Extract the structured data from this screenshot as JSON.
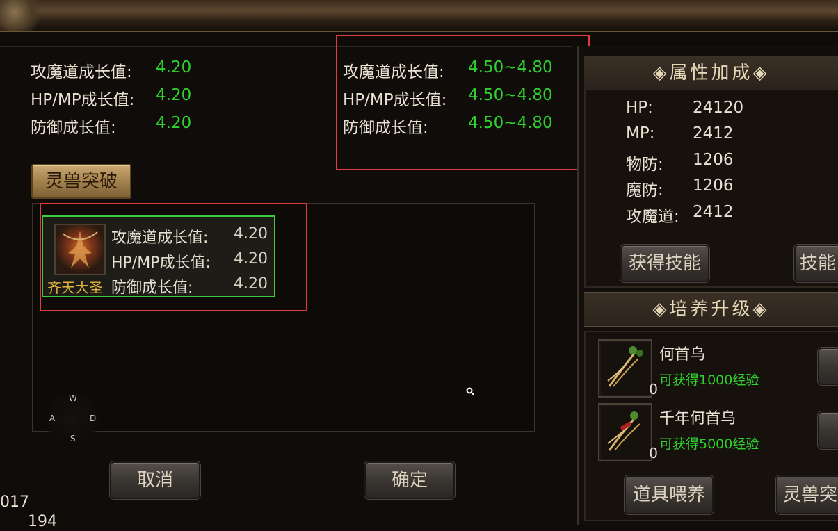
{
  "current_growth": [
    {
      "label": "攻魔道成长值:",
      "value": "4.20"
    },
    {
      "label": "HP/MP成长值:",
      "value": "4.20"
    },
    {
      "label": "防御成长值:",
      "value": "4.20"
    }
  ],
  "target_growth": [
    {
      "label": "攻魔道成长值:",
      "value": "4.50~4.80"
    },
    {
      "label": "HP/MP成长值:",
      "value": "4.50~4.80"
    },
    {
      "label": "防御成长值:",
      "value": "4.50~4.80"
    }
  ],
  "breakthrough_tab": "灵兽突破",
  "pet_card": {
    "name": "齐天大圣",
    "stats": [
      {
        "label": "攻魔道成长值:",
        "value": "4.20"
      },
      {
        "label": "HP/MP成长值:",
        "value": "4.20"
      },
      {
        "label": "防御成长值:",
        "value": "4.20"
      }
    ]
  },
  "joystick": {
    "up": "W",
    "left": "A",
    "right": "D",
    "down": "S"
  },
  "buttons": {
    "cancel": "取消",
    "confirm": "确定"
  },
  "corner_numbers": {
    "a": "017",
    "b": "194"
  },
  "attributes": {
    "header": "◈属性加成◈",
    "rows": [
      {
        "label": "HP:",
        "value": "24120"
      },
      {
        "label": "MP:",
        "value": "2412"
      },
      {
        "label": "物防:",
        "value": "1206"
      },
      {
        "label": "魔防:",
        "value": "1206"
      },
      {
        "label": "攻魔道:",
        "value": "2412"
      }
    ],
    "btn_skills": "获得技能",
    "btn_skills2": "技能"
  },
  "training": {
    "header": "◈培养升级◈",
    "items": [
      {
        "name": "何首乌",
        "desc": "可获得1000经验",
        "count": "0"
      },
      {
        "name": "千年何首乌",
        "desc": "可获得5000经验",
        "count": "0"
      }
    ],
    "btn_feed": "道具喂养",
    "btn_break": "灵兽突"
  },
  "colors": {
    "accent_green": "#2ed12e",
    "highlight_red": "#e03c3c",
    "gold": "#e0b43a"
  }
}
